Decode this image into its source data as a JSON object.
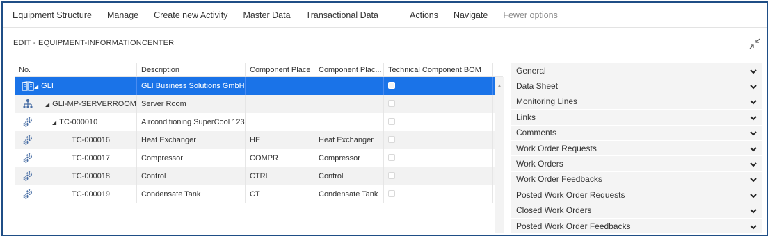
{
  "toolbar": {
    "items": [
      "Equipment Structure",
      "Manage",
      "Create new Activity",
      "Master Data",
      "Transactional Data"
    ],
    "actions": "Actions",
    "navigate": "Navigate",
    "fewer": "Fewer options"
  },
  "section_title": "EDIT - EQUIPMENT-INFORMATIONCENTER",
  "grid": {
    "columns": [
      "No.",
      "Description",
      "Component Place",
      "Component Plac...",
      "Technical Component BOM"
    ],
    "rows": [
      {
        "no": "GLI",
        "description": "GLI Business Solutions GmbH",
        "place": "",
        "place2": "",
        "icon": "book-icon",
        "level": 0,
        "selected": true
      },
      {
        "no": "GLI-MP-SERVERROOM",
        "description": "Server Room",
        "place": "",
        "place2": "",
        "icon": "hierarchy-icon",
        "level": 1,
        "selected": false
      },
      {
        "no": "TC-000010",
        "description": "Airconditioning SuperCool 123",
        "place": "",
        "place2": "",
        "icon": "gears-icon",
        "level": 2,
        "selected": false
      },
      {
        "no": "TC-000016",
        "description": "Heat Exchanger",
        "place": "HE",
        "place2": "Heat Exchanger",
        "icon": "gears-icon",
        "level": 3,
        "selected": false
      },
      {
        "no": "TC-000017",
        "description": "Compressor",
        "place": "COMPR",
        "place2": "Compressor",
        "icon": "gears-icon",
        "level": 3,
        "selected": false
      },
      {
        "no": "TC-000018",
        "description": "Control",
        "place": "CTRL",
        "place2": "Control",
        "icon": "gears-icon",
        "level": 3,
        "selected": false
      },
      {
        "no": "TC-000019",
        "description": "Condensate Tank",
        "place": "CT",
        "place2": "Condensate Tank",
        "icon": "gears-icon",
        "level": 3,
        "selected": false
      }
    ]
  },
  "accordion": [
    "General",
    "Data Sheet",
    "Monitoring Lines",
    "Links",
    "Comments",
    "Work Order Requests",
    "Work Orders",
    "Work Order Feedbacks",
    "Posted Work Order Requests",
    "Closed Work Orders",
    "Posted Work Order Feedbacks"
  ],
  "colors": {
    "accent": "#1a73e8",
    "frame": "#1f4e86",
    "icon": "#4a6fa5"
  }
}
